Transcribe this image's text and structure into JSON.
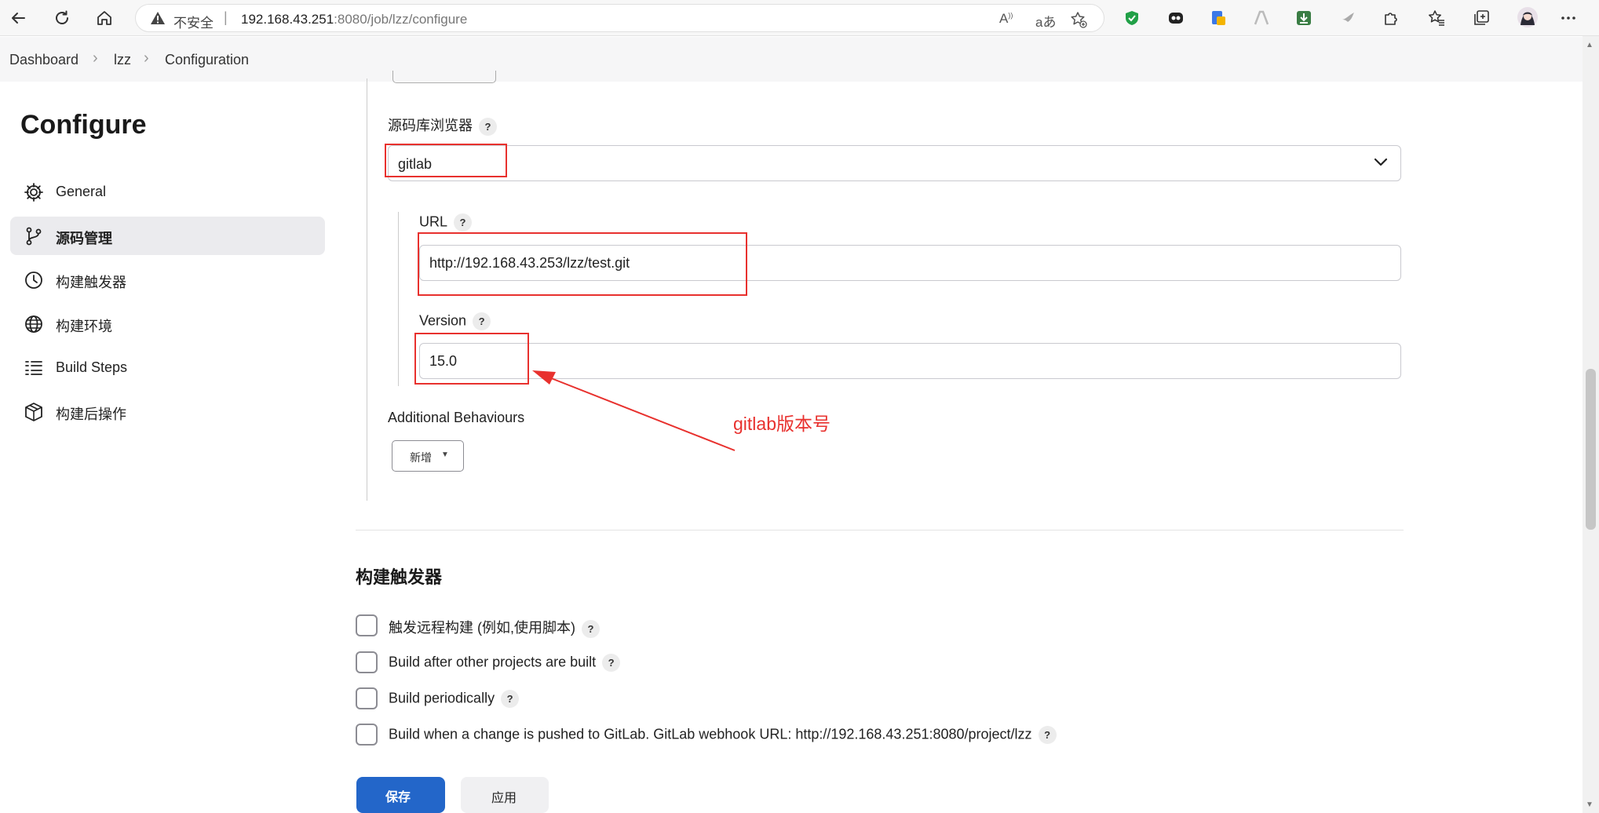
{
  "browser": {
    "insecure_label": "不安全",
    "url_host": "192.168.43.251",
    "url_rest": ":8080/job/lzz/configure"
  },
  "breadcrumb": {
    "items": [
      "Dashboard",
      "lzz",
      "Configuration"
    ]
  },
  "sidebar": {
    "title": "Configure",
    "items": [
      {
        "label": "General",
        "icon": "gear-icon"
      },
      {
        "label": "源码管理",
        "icon": "branch-icon"
      },
      {
        "label": "构建触发器",
        "icon": "clock-icon"
      },
      {
        "label": "构建环境",
        "icon": "globe-icon"
      },
      {
        "label": "Build Steps",
        "icon": "list-icon"
      },
      {
        "label": "构建后操作",
        "icon": "cube-icon"
      }
    ]
  },
  "scm": {
    "repo_browser_label": "源码库浏览器",
    "repo_browser_value": "gitlab",
    "url_label": "URL",
    "url_value": "http://192.168.43.253/lzz/test.git",
    "version_label": "Version",
    "version_value": "15.0",
    "additional_label": "Additional Behaviours",
    "add_button": "新增",
    "help": "?"
  },
  "annotation": {
    "text": "gitlab版本号",
    "color": "#e8312e"
  },
  "triggers": {
    "heading": "构建触发器",
    "options": [
      "触发远程构建 (例如,使用脚本)",
      "Build after other projects are built",
      "Build periodically",
      "Build when a change is pushed to GitLab. GitLab webhook URL: http://192.168.43.251:8080/project/lzz"
    ]
  },
  "footer": {
    "save": "保存",
    "apply": "应用"
  },
  "colors": {
    "primary": "#2366c9",
    "annotation_red": "#e8312e"
  }
}
